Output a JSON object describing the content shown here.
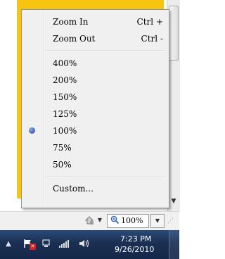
{
  "zoom_menu": {
    "items": [
      {
        "label": "Zoom In",
        "shortcut": "Ctrl +"
      },
      {
        "label": "Zoom Out",
        "shortcut": "Ctrl -"
      },
      {
        "label": "400%"
      },
      {
        "label": "200%"
      },
      {
        "label": "150%"
      },
      {
        "label": "125%"
      },
      {
        "label": "100%",
        "selected": true
      },
      {
        "label": "75%"
      },
      {
        "label": "50%"
      },
      {
        "label": "Custom..."
      }
    ]
  },
  "status_bar": {
    "zoom_value": "100%",
    "icons": [
      "security-icon",
      "zoom-icon"
    ]
  },
  "taskbar": {
    "time": "7:23 PM",
    "date": "9/26/2010",
    "icons": [
      "chevron-up-icon",
      "action-center-flag-icon",
      "network-icon",
      "signal-icon",
      "volume-icon"
    ]
  },
  "colors": {
    "page_background": "#f7c410",
    "radio_selected": "#1c3f98",
    "taskbar": "#1a2f52"
  }
}
